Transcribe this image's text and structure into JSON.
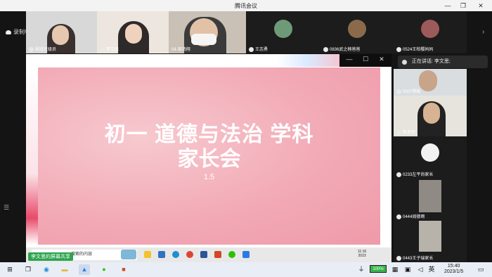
{
  "window": {
    "title": "腾讯会议",
    "minimize": "—",
    "restore": "❐",
    "maximize": "☐",
    "close": "✕"
  },
  "recording": {
    "label": "录制中"
  },
  "top_participants": [
    {
      "name": "副班班级员"
    },
    {
      "name": "李文思"
    },
    {
      "name": "04-邹鸿翔"
    },
    {
      "name": "王志勇"
    },
    {
      "name": "0836武之楠爸爸"
    },
    {
      "name": "0524王柏樱妈妈"
    }
  ],
  "screen_share": {
    "controls": {
      "minimize": "—",
      "maximize": "☐",
      "close": "✕"
    },
    "slide": {
      "title_line1": "初一 道德与法治 学科",
      "title_line2": "家长会",
      "subtitle": "1.5"
    },
    "remote_taskbar": {
      "search_placeholder": "搜索的内容",
      "time": "11:16",
      "date": "2023"
    },
    "sharer_label": "李文思的屏幕共享"
  },
  "speaking": {
    "label": "正在讲话: 李文思;"
  },
  "side_participants": [
    {
      "name": "0507黑板"
    },
    {
      "name": "陈老师"
    },
    {
      "name": "0233左平尚家长"
    },
    {
      "name": "0444阎德雨"
    },
    {
      "name": "0443王子瑞家长"
    }
  ],
  "taskbar": {
    "battery": "100%",
    "ime": "英",
    "time": "15:40",
    "date": "2023/1/5"
  }
}
